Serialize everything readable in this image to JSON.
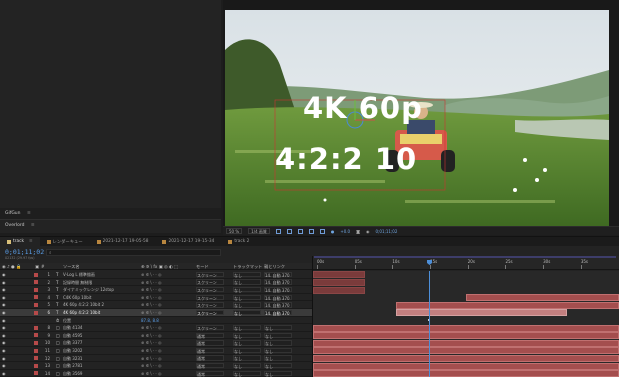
{
  "left_panel": {
    "tab_gifgun": "GifGun",
    "tab_overlord": "Overlord",
    "menu_glyph": "≡"
  },
  "viewer": {
    "overlay_line1": "4K 60p",
    "overlay_line2": "4:2:2 10",
    "toolbar": {
      "zoom": "50 %",
      "resolution": "1/4 画質",
      "exposure": "+0.0",
      "timecode": "0;01;11;02"
    }
  },
  "timeline": {
    "tabs": [
      {
        "label": "track",
        "active": true
      },
      {
        "label": "レンダーキュー",
        "active": false
      },
      {
        "label": "2021-12-17 19-05-58",
        "active": false
      },
      {
        "label": "2021-12-17 19-15-34",
        "active": false
      },
      {
        "label": "track 2",
        "active": false
      }
    ],
    "close_glyph": "≡",
    "timecode": "0;01;11;02",
    "fps": "02132 (29.97 fps)",
    "search_icon": "search-icon",
    "columns": {
      "source_name": "ソース名",
      "mode": "モード",
      "track_matte": "トラックマット",
      "parent": "親とリンク"
    },
    "ruler_labels": [
      "00s",
      "05s",
      "10s",
      "15s",
      "20s",
      "25s",
      "30s",
      "35s"
    ],
    "playhead_fraction": 0.38,
    "layers": [
      {
        "num": "1",
        "type": "T",
        "name": "V-Log L 標準描画",
        "mode": "スクリーン",
        "matte": "なし",
        "parent": "14. 自動 370",
        "selected": false,
        "bar": [
          0.0,
          0.17
        ]
      },
      {
        "num": "2",
        "type": "T",
        "name": "記録時間 無制限",
        "mode": "スクリーン",
        "matte": "なし",
        "parent": "14. 自動 370",
        "selected": false,
        "bar": [
          0.0,
          0.17
        ]
      },
      {
        "num": "3",
        "type": "T",
        "name": "ダイナミックレンジ 12stop",
        "mode": "スクリーン",
        "matte": "なし",
        "parent": "14. 自動 370",
        "selected": false,
        "bar": [
          0.0,
          0.17
        ]
      },
      {
        "num": "4",
        "type": "T",
        "name": "C4K 60p 10bit",
        "mode": "スクリーン",
        "matte": "なし",
        "parent": "14. 自動 370",
        "selected": false,
        "bar": [
          0.5,
          1.0
        ]
      },
      {
        "num": "5",
        "type": "T",
        "name": "4K 60p 4:2:2 10bit 2",
        "mode": "スクリーン",
        "matte": "なし",
        "parent": "14. 自動 370",
        "selected": false,
        "bar": [
          0.27,
          1.0
        ]
      },
      {
        "num": "6",
        "type": "T",
        "name": "4K 60p 4:2:2 10bit",
        "mode": "スクリーン",
        "matte": "なし",
        "parent": "14. 自動 370",
        "selected": true,
        "bar": [
          0.27,
          0.83
        ]
      },
      {
        "num": "",
        "type": "⏱",
        "name": "位置",
        "mode": "",
        "matte": "",
        "parent": "",
        "selected": false,
        "bar": null,
        "sub_value": "87.8, 8.8"
      },
      {
        "num": "8",
        "type": "□",
        "name": "自動 4134",
        "mode": "スクリーン",
        "matte": "なし",
        "parent": "なし",
        "selected": false,
        "bar": [
          0.0,
          1.0
        ]
      },
      {
        "num": "9",
        "type": "□",
        "name": "自動 4595",
        "mode": "通常",
        "matte": "なし",
        "parent": "なし",
        "selected": false,
        "bar": [
          0.0,
          1.0
        ]
      },
      {
        "num": "10",
        "type": "□",
        "name": "自動 3377",
        "mode": "通常",
        "matte": "なし",
        "parent": "なし",
        "selected": false,
        "bar": [
          0.0,
          1.0
        ]
      },
      {
        "num": "11",
        "type": "□",
        "name": "自動 3202",
        "mode": "通常",
        "matte": "なし",
        "parent": "なし",
        "selected": false,
        "bar": [
          0.0,
          1.0
        ]
      },
      {
        "num": "12",
        "type": "□",
        "name": "自動 3231",
        "mode": "通常",
        "matte": "なし",
        "parent": "なし",
        "selected": false,
        "bar": [
          0.0,
          1.0
        ]
      },
      {
        "num": "13",
        "type": "□",
        "name": "自動 2781",
        "mode": "通常",
        "matte": "なし",
        "parent": "なし",
        "selected": false,
        "bar": [
          0.0,
          1.0
        ]
      },
      {
        "num": "14",
        "type": "□",
        "name": "自動 3569",
        "mode": "通常",
        "matte": "なし",
        "parent": "なし",
        "selected": false,
        "bar": [
          0.0,
          1.0
        ]
      }
    ]
  }
}
